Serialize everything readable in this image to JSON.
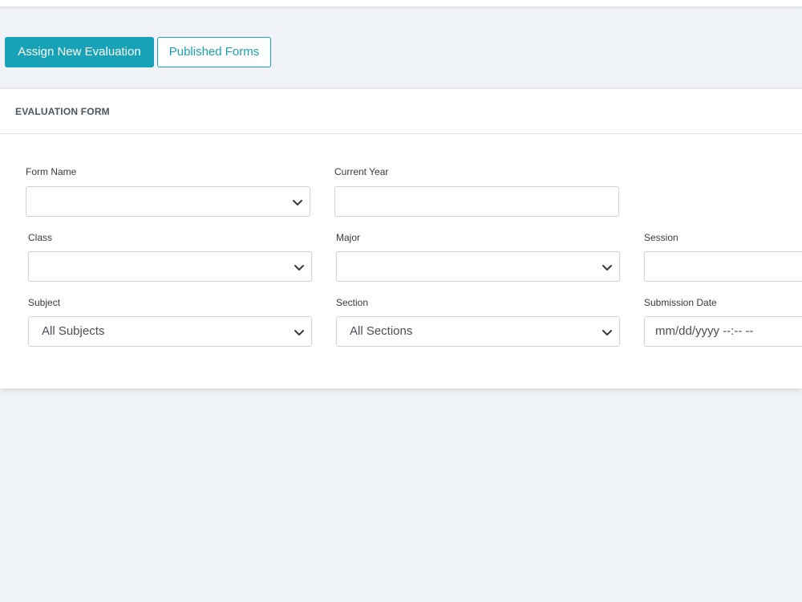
{
  "toolbar": {
    "assign_label": "Assign New Evaluation",
    "published_label": "Published Forms"
  },
  "card": {
    "title": "EVALUATION FORM"
  },
  "fields": {
    "form_name": {
      "label": "Form Name",
      "value": ""
    },
    "current_year": {
      "label": "Current Year",
      "value": ""
    },
    "class": {
      "label": "Class",
      "value": ""
    },
    "major": {
      "label": "Major",
      "value": ""
    },
    "session": {
      "label": "Session",
      "value": ""
    },
    "subject": {
      "label": "Subject",
      "value": "All Subjects"
    },
    "section": {
      "label": "Section",
      "value": "All Sections"
    },
    "submission_date": {
      "label": "Submission Date",
      "placeholder": "mm/dd/yyyy  --:--  --"
    }
  },
  "colors": {
    "accent": "#17a2b8",
    "background": "#eff2f7",
    "border": "#ced4da"
  },
  "icons": {
    "select_arrow": "chevron-down-icon"
  }
}
